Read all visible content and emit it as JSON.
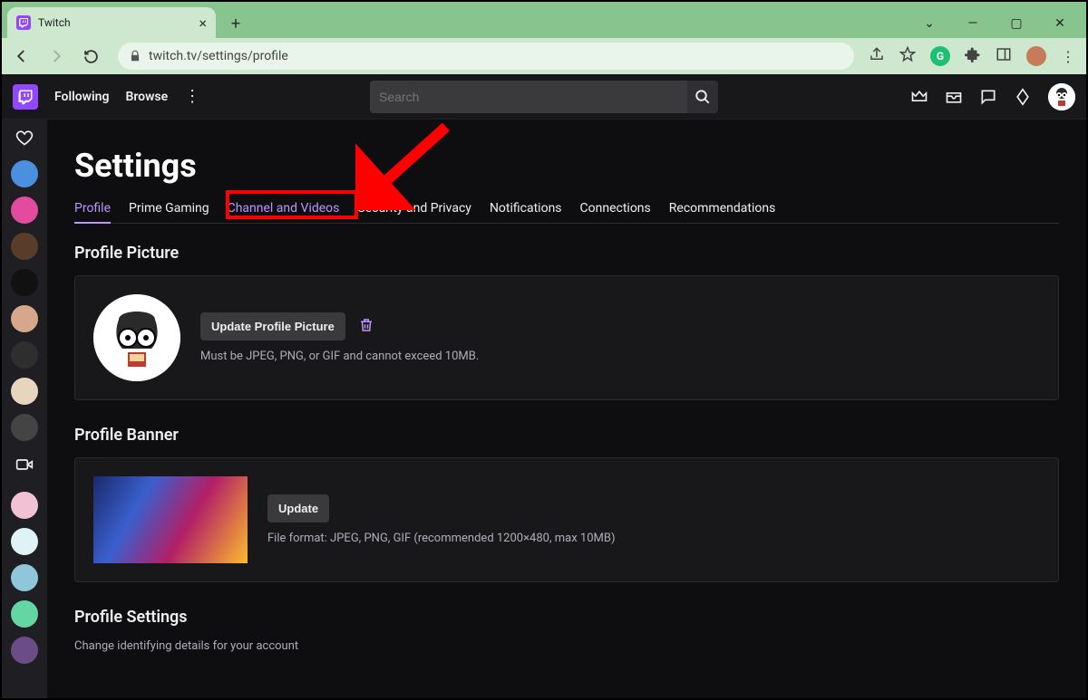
{
  "browser": {
    "tab_title": "Twitch",
    "url": "twitch.tv/settings/profile"
  },
  "topnav": {
    "following": "Following",
    "browse": "Browse",
    "search_placeholder": "Search"
  },
  "page_title": "Settings",
  "tabs": [
    {
      "label": "Profile",
      "active": true
    },
    {
      "label": "Prime Gaming"
    },
    {
      "label": "Channel and Videos",
      "highlighted": true
    },
    {
      "label": "Security and Privacy"
    },
    {
      "label": "Notifications"
    },
    {
      "label": "Connections"
    },
    {
      "label": "Recommendations"
    }
  ],
  "profile_picture": {
    "section_title": "Profile Picture",
    "button": "Update Profile Picture",
    "hint": "Must be JPEG, PNG, or GIF and cannot exceed 10MB."
  },
  "profile_banner": {
    "section_title": "Profile Banner",
    "button": "Update",
    "hint": "File format: JPEG, PNG, GIF (recommended 1200×480, max 10MB)"
  },
  "profile_settings": {
    "section_title": "Profile Settings",
    "subtitle": "Change identifying details for your account"
  }
}
